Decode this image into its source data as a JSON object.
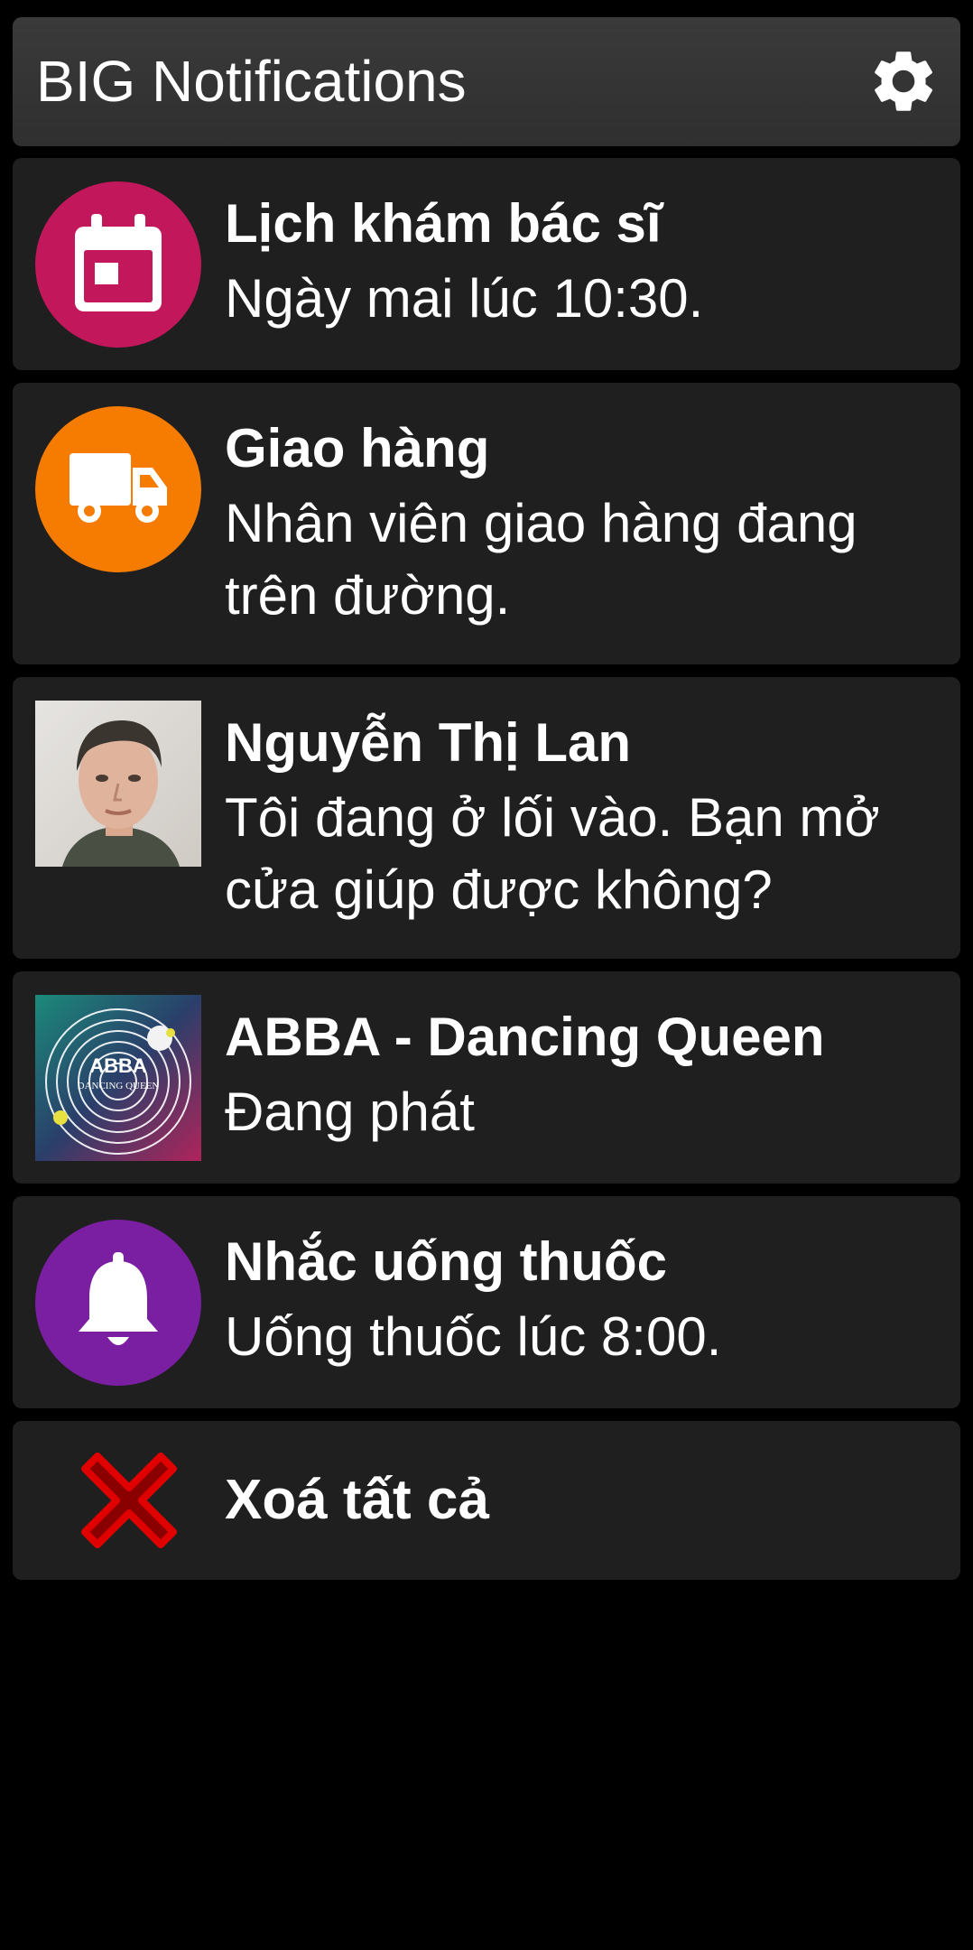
{
  "header": {
    "title": "BIG Notifications",
    "settings_icon": "gear-icon"
  },
  "notifications": [
    {
      "title": "Lịch khám bác sĩ",
      "body": "Ngày mai lúc 10:30.",
      "icon": "calendar-icon",
      "color": "#c2185b"
    },
    {
      "title": "Giao hàng",
      "body": "Nhân viên giao hàng đang trên đường.",
      "icon": "truck-icon",
      "color": "#f57c00"
    },
    {
      "title": "Nguyễn Thị Lan",
      "body": "Tôi đang ở lối vào. Bạn mở cửa giúp được không?",
      "icon": "contact-avatar"
    },
    {
      "title": "ABBA - Dancing Queen",
      "body": "Đang phát",
      "icon": "album-art",
      "album_art_text": "ABBA",
      "album_art_subtext": "DANCING QUEEN"
    },
    {
      "title": "Nhắc uống thuốc",
      "body": "Uống thuốc lúc 8:00.",
      "icon": "bell-icon",
      "color": "#7b1fa2"
    }
  ],
  "clear_all": {
    "label": "Xoá tất cả",
    "icon": "close-x-icon",
    "color": "#e00000"
  },
  "colors": {
    "background": "#000000",
    "card": "#1f1f1f",
    "header": "#363636",
    "text": "#ffffff"
  }
}
